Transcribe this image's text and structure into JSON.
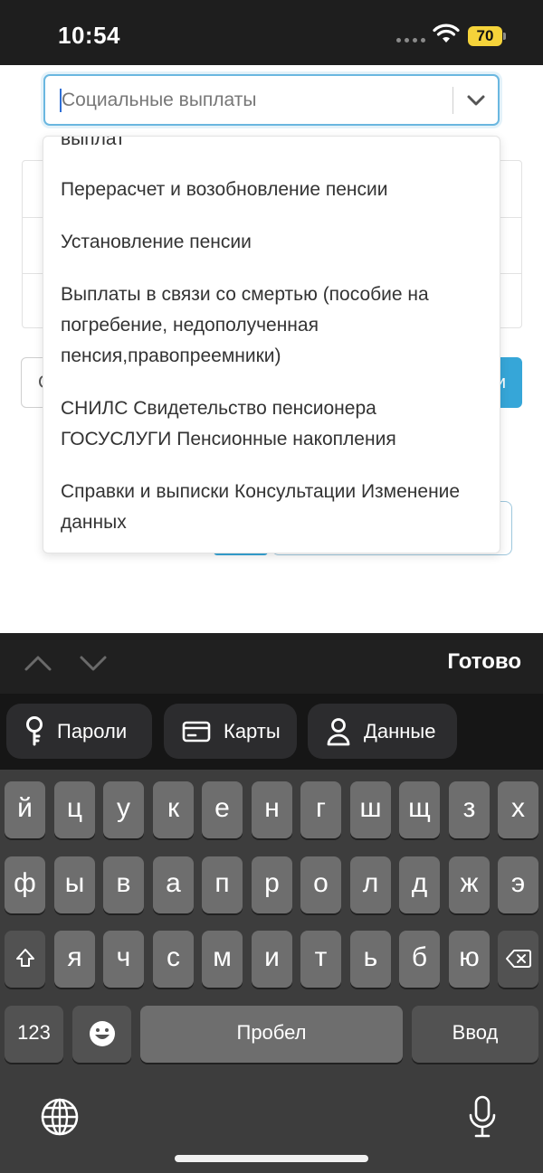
{
  "status_bar": {
    "time": "10:54",
    "battery": "70"
  },
  "page_behind": {
    "left_button_label": "С",
    "right_button_label": "и"
  },
  "select": {
    "value": "Социальные выплаты"
  },
  "menu": {
    "items": [
      {
        "label": "выплат"
      },
      {
        "label": "Перерасчет и возобновление пенсии"
      },
      {
        "label": "Установление пенсии"
      },
      {
        "label": "Выплаты в связи со смертью (пособие на погребение, недополученная пенсия,правопреемники)"
      },
      {
        "label": "СНИЛС Свидетельство пенсионера ГОСУСЛУГИ Пенсионные накопления"
      },
      {
        "label": "Справки и выписки Консультации Изменение данных"
      }
    ]
  },
  "accessory": {
    "done": "Готово"
  },
  "suggestions": [
    {
      "label": "Пароли",
      "icon": "key-icon"
    },
    {
      "label": "Карты",
      "icon": "card-icon"
    },
    {
      "label": "Данные",
      "icon": "person-icon"
    }
  ],
  "keyboard": {
    "row1": [
      "й",
      "ц",
      "у",
      "к",
      "е",
      "н",
      "г",
      "ш",
      "щ",
      "з",
      "х"
    ],
    "row2": [
      "ф",
      "ы",
      "в",
      "а",
      "п",
      "р",
      "о",
      "л",
      "д",
      "ж",
      "э"
    ],
    "row3": [
      "я",
      "ч",
      "с",
      "м",
      "и",
      "т",
      "ь",
      "б",
      "ю"
    ],
    "numbers_key": "123",
    "space_key": "Пробел",
    "return_key": "Ввод"
  }
}
